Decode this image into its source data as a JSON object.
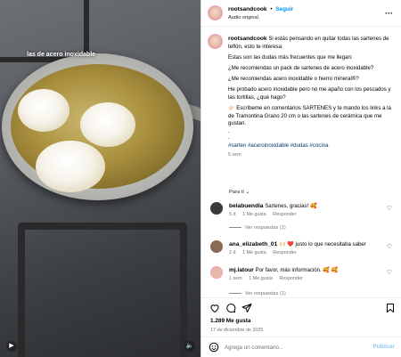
{
  "media": {
    "caption_overlay": "las de acero inoxidable",
    "play_icon": "play-icon",
    "sound_icon": "speaker-icon"
  },
  "header": {
    "username": "rootsandcook",
    "separator": "•",
    "follow_label": "Seguir",
    "audio_label": "Audio original",
    "more_icon": "more-options-icon"
  },
  "post": {
    "username": "rootsandcook",
    "caption_intro": "Si estás pensando en quitar todas las sartenes de teflón, esto te interesa:",
    "paragraphs": [
      "Estas son las dudas más frecuentes que me llegan:",
      "¿Me recomiendas un pack de sartenes de acero inoxidable?",
      "¿Me recomiendas acero inoxidable o hierro mineral®?",
      "He probado acero inoxidable pero no me apaño con los pescados y las tortillas, ¿qué hago?",
      "👉🏻 Escríbeme en comentarios SARTENES y te mando los links a la de Tramontina Grano 20 cm o las sartenes de cerámica que me gustan.",
      ".",
      "."
    ],
    "hashtags": "#sarten #aceroinoxidable #dudas #cocina",
    "time": "5 sem",
    "translate_hint": "Para ti ⌄"
  },
  "comments": [
    {
      "username": "belabuendia",
      "text": "Sartenes, gracias! 🥰",
      "age": "5 d",
      "likes": "1 Me gusta",
      "reply": "Responder",
      "view_replies": "Ver respuestas (1)",
      "avatar_color": "#3a3a3a"
    },
    {
      "username": "ana_elizabeth_01",
      "text": "🙌🏻 ❤️ justo lo que necesitaba saber",
      "age": "2 d",
      "likes": "1 Me gusta",
      "reply": "Responder",
      "avatar_color": "#8a6a55"
    },
    {
      "username": "mj.latour",
      "text": "Por favor, más información. 🥰 🥰",
      "age": "1 sem",
      "likes": "1 Me gusta",
      "reply": "Responder",
      "view_replies": "Ver respuestas (1)",
      "avatar_color": "#e8b8a6"
    }
  ],
  "actions": {
    "like_icon": "heart-icon",
    "comment_icon": "comment-icon",
    "share_icon": "share-icon",
    "save_icon": "bookmark-icon",
    "likes_count": "1.289 Me gusta",
    "date": "17 de diciembre de 2025"
  },
  "add_comment": {
    "placeholder": "Agrega un comentario...",
    "publish_label": "Publicar",
    "emoji_icon": "emoji-icon"
  }
}
